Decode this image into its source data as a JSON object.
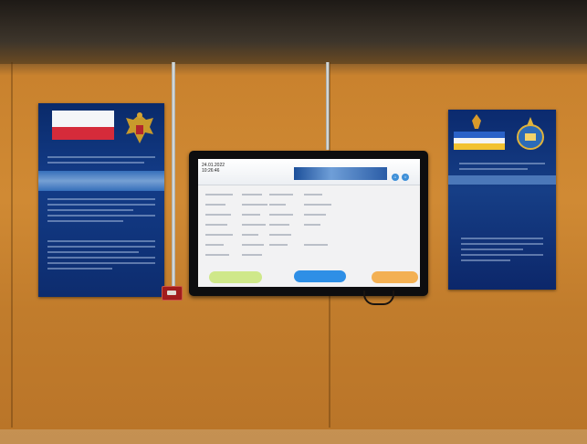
{
  "scene": {
    "description_free": true,
    "colors": {
      "wall": "#d08a34",
      "ceiling": "#2b2520",
      "poster_bg": "#0d2c6e",
      "tv_frame": "#0d0d0f",
      "screen_bg": "#f2f2f3"
    }
  },
  "tv_screen": {
    "date_line": "24.01.2022",
    "time_line": "10:26:46",
    "buttons": [
      "",
      "",
      ""
    ]
  }
}
